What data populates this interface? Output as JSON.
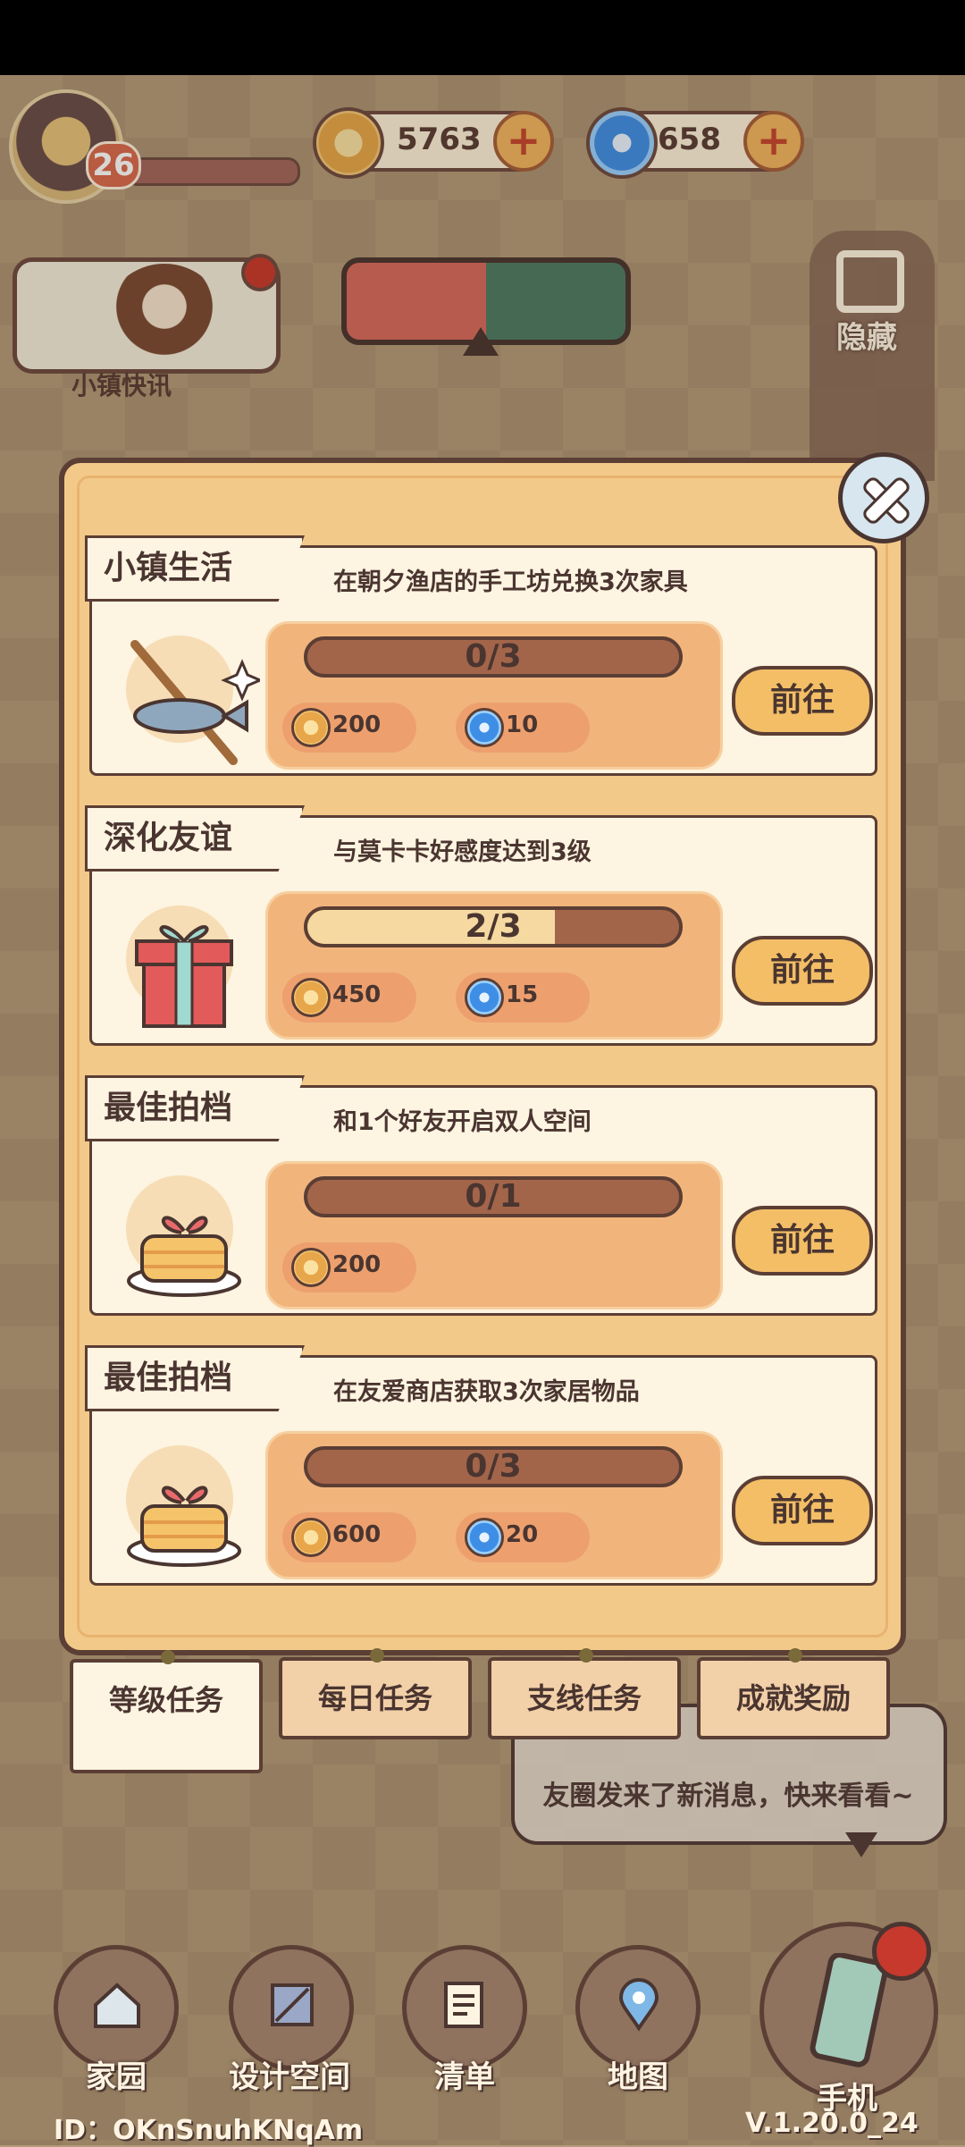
{
  "hud": {
    "level": "26",
    "gold": "5763",
    "gems": "658",
    "news_label": "小镇快讯",
    "hide_label": "隐藏"
  },
  "tasks": [
    {
      "category": "小镇生活",
      "desc": "在朝夕渔店的手工坊兑换3次家具",
      "progress_text": "0/3",
      "progress": 0.0,
      "rewards": [
        {
          "type": "gold",
          "value": "200"
        },
        {
          "type": "gem",
          "value": "10"
        }
      ],
      "go": "前往",
      "icon": "fishing-rod-icon"
    },
    {
      "category": "深化友谊",
      "desc": "与莫卡卡好感度达到3级",
      "progress_text": "2/3",
      "progress": 0.6667,
      "rewards": [
        {
          "type": "gold",
          "value": "450"
        },
        {
          "type": "gem",
          "value": "15"
        }
      ],
      "go": "前往",
      "icon": "gift-box-icon"
    },
    {
      "category": "最佳拍档",
      "desc": "和1个好友开启双人空间",
      "progress_text": "0/1",
      "progress": 0.0,
      "rewards": [
        {
          "type": "gold",
          "value": "200"
        }
      ],
      "go": "前往",
      "icon": "cake-icon"
    },
    {
      "category": "最佳拍档",
      "desc": "在友爱商店获取3次家居物品",
      "progress_text": "0/3",
      "progress": 0.0,
      "rewards": [
        {
          "type": "gold",
          "value": "600"
        },
        {
          "type": "gem",
          "value": "20"
        }
      ],
      "go": "前往",
      "icon": "cake-icon"
    }
  ],
  "tabs": [
    "等级任务",
    "每日任务",
    "支线任务",
    "成就奖励"
  ],
  "active_tab": 0,
  "notification": {
    "text": "友圈发来了新消息，快来看看~"
  },
  "nav": [
    "家园",
    "设计空间",
    "清单",
    "地图",
    "手机"
  ],
  "footer": {
    "id": "ID：OKnSnuhKNqAm",
    "version": "V.1.20.0_24"
  },
  "colors": {
    "panel": "#f3c989",
    "card": "#fdf4e1",
    "outline": "#5b3e34",
    "accent_red": "#c7392d"
  }
}
